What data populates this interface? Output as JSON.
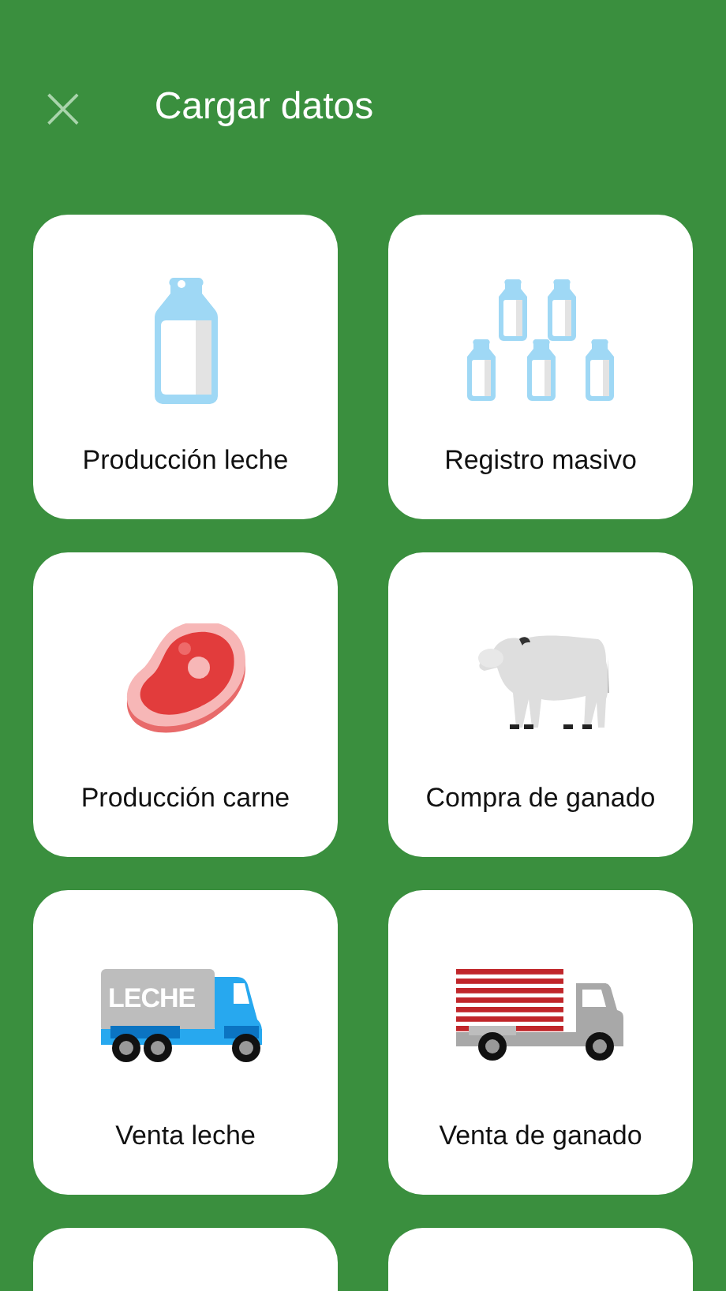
{
  "header": {
    "close": "×",
    "title": "Cargar datos"
  },
  "cards": [
    {
      "kind": "bottle",
      "label": "Producción leche"
    },
    {
      "kind": "bottles",
      "label": "Registro masivo"
    },
    {
      "kind": "meat",
      "label": "Producción carne"
    },
    {
      "kind": "cow",
      "label": "Compra de ganado"
    },
    {
      "kind": "milk-truck",
      "label": "Venta leche",
      "truck_text": "LECHE"
    },
    {
      "kind": "cattle-truck",
      "label": "Venta de ganado"
    },
    {
      "kind": "blank"
    },
    {
      "kind": "blank"
    }
  ]
}
